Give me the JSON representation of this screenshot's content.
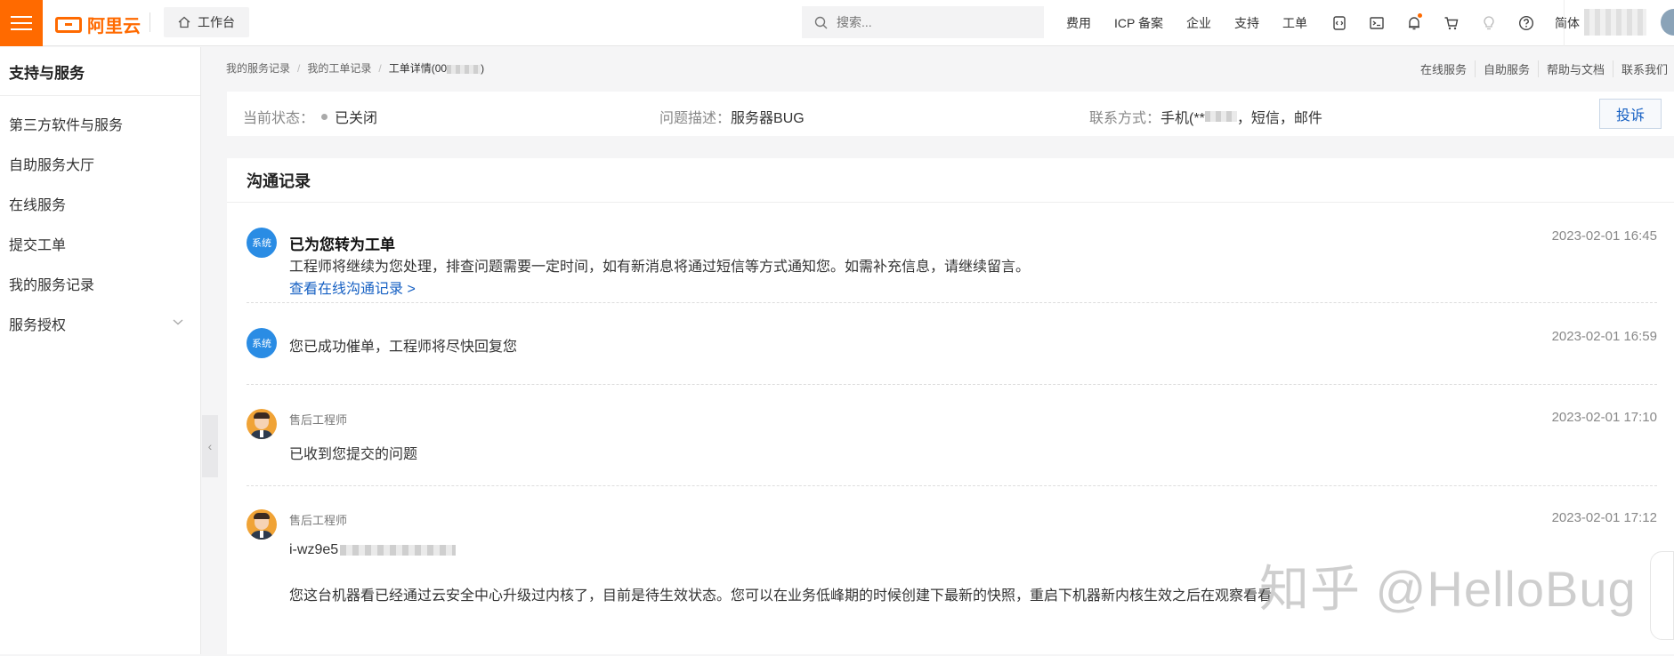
{
  "topbar": {
    "brand": "阿里云",
    "workbench_label": "工作台",
    "search_placeholder": "搜索...",
    "nav_items": [
      "费用",
      "ICP 备案",
      "企业",
      "支持",
      "工单"
    ],
    "lang_label": "简体",
    "icons": [
      "code-icon",
      "terminal-icon",
      "bell-icon",
      "cart-icon",
      "bulb-icon",
      "help-icon"
    ],
    "accent_color": "#ff6a00"
  },
  "sidebar": {
    "title": "支持与服务",
    "items": [
      {
        "label": "第三方软件与服务"
      },
      {
        "label": "自助服务大厅"
      },
      {
        "label": "在线服务"
      },
      {
        "label": "提交工单"
      },
      {
        "label": "我的服务记录"
      },
      {
        "label": "服务授权"
      }
    ]
  },
  "breadcrumb": {
    "items": [
      "我的服务记录",
      "我的工单记录"
    ],
    "current_prefix": "工单详情(00",
    "current_suffix": ")"
  },
  "help_links": [
    "在线服务",
    "自助服务",
    "帮助与文档",
    "联系我们"
  ],
  "status": {
    "state_label": "当前状态：",
    "state_value": "已关闭",
    "desc_label": "问题描述：",
    "desc_value": "服务器BUG",
    "contact_label": "联系方式：",
    "contact_prefix": "手机(**",
    "contact_suffix": "，短信，邮件",
    "complain_button": "投诉"
  },
  "panel": {
    "title": "沟通记录",
    "messages": [
      {
        "sender_type": "system",
        "avatar_label": "系统",
        "title": "已为您转为工单",
        "body": "工程师将继续为您处理，排查问题需要一定时间，如有新消息将通过短信等方式通知您。如需补充信息，请继续留言。",
        "link": "查看在线沟通记录 >",
        "time": "2023-02-01 16:45"
      },
      {
        "sender_type": "system",
        "avatar_label": "系统",
        "body": "您已成功催单，工程师将尽快回复您",
        "time": "2023-02-01 16:59"
      },
      {
        "sender_type": "engineer",
        "sender": "售后工程师",
        "body": "已收到您提交的问题",
        "time": "2023-02-01 17:10"
      },
      {
        "sender_type": "engineer",
        "sender": "售后工程师",
        "instance_prefix": "i-wz9e5",
        "body": "您这台机器看已经通过云安全中心升级过内核了，目前是待生效状态。您可以在业务低峰期的时候创建下最新的快照，重启下机器新内核生效之后在观察看看",
        "time": "2023-02-01 17:12"
      }
    ]
  },
  "watermark": "知乎 @HelloBug"
}
